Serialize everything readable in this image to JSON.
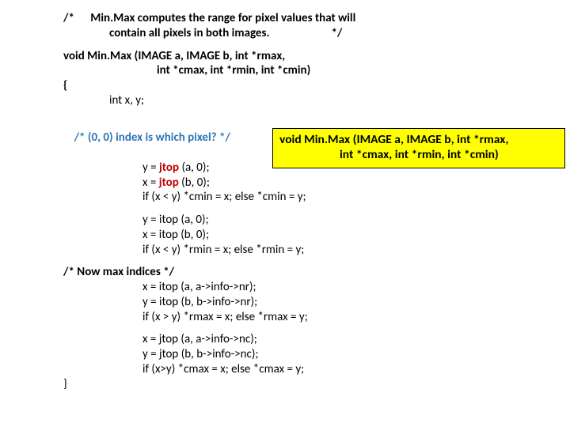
{
  "comment_top_a": "/*      Min.Max computes the range for pixel values that will",
  "comment_top_b": "contain all pixels in both images.                       */",
  "sig_a": "void Min.Max (IMAGE a, IMAGE b, int *rmax,",
  "sig_b": "int *cmax, int *rmin, int *cmin)",
  "brace_open": "{",
  "decl": "int x, y;",
  "comment_idx": "/* (0, 0) index is which pixel? */",
  "b1_l1_a": "y = ",
  "b1_l1_fn": "jtop",
  "b1_l1_b": " (a, 0);",
  "b1_l2_a": "x = ",
  "b1_l2_fn": "jtop",
  "b1_l2_b": " (b, 0);",
  "b1_l3": "if (x < y) *cmin = x; else *cmin = y;",
  "b2_l1": "y = itop (a, 0);",
  "b2_l2": "x = itop (b, 0);",
  "b2_l3": "if (x < y) *rmin = x; else *rmin = y;",
  "comment_max": "/* Now max indices */",
  "b3_l1": "x = itop (a, a->info->nr);",
  "b3_l2": "y = itop (b, b->info->nr);",
  "b3_l3": "if (x > y) *rmax = x; else *rmax = y;",
  "b4_l1": "x = jtop (a, a->info->nc);",
  "b4_l2": "y = jtop (b, b->info->nc);",
  "b4_l3": "if (x>y) *cmax = x; else *cmax = y;",
  "brace_close": "}",
  "callout_l1": "void Min.Max (IMAGE a, IMAGE b, int *rmax,",
  "callout_l2": "int *cmax, int *rmin, int *cmin)"
}
